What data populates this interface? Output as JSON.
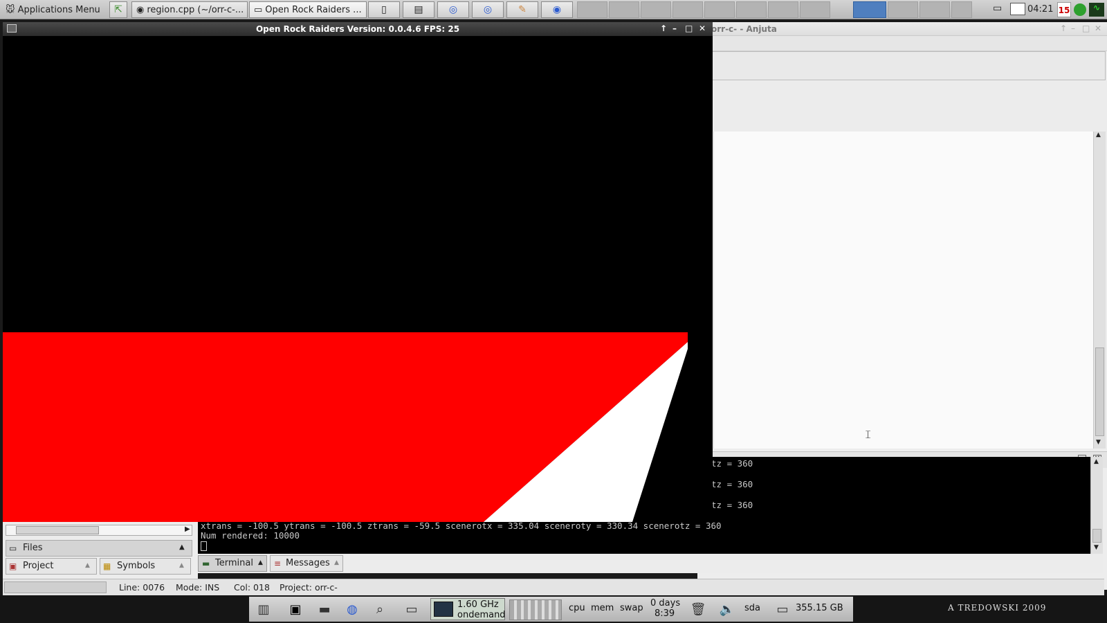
{
  "top_panel": {
    "apps_menu_label": "Applications Menu",
    "tasks": [
      {
        "label": "region.cpp (~/orr-c-..."
      },
      {
        "label": "Open Rock Raiders ..."
      }
    ],
    "clock": "04:21",
    "calendar_day": "15"
  },
  "game_window": {
    "title": "Open Rock Raiders Version: 0.0.4.6 FPS: 25",
    "colors": {
      "ground": "#ff0000",
      "wall": "#ffffff",
      "sky": "#000000"
    }
  },
  "anjuta": {
    "title_fragment": "orr-c- - Anjuta",
    "terminal_lines": [
      "tz = 360",
      "tz = 360",
      "tz = 360",
      "tz = 360"
    ],
    "terminal_full_line": "xtrans = -100.5 ytrans = -100.5 ztrans = -59.5 scenerotx = 335.04 sceneroty = 330.34 scenerotz = 360",
    "terminal_last": "Num rendered: 10000",
    "left_tabs": {
      "files": "Files",
      "project": "Project",
      "symbols": "Symbols"
    },
    "bottom_tabs": {
      "terminal": "Terminal",
      "messages": "Messages"
    },
    "status": {
      "line": "Line: 0076",
      "mode": "Mode: INS",
      "col": "Col: 018",
      "project": "Project: orr-c-"
    }
  },
  "bottom_panel": {
    "cpu_freq": "1.60 GHz",
    "governor": "ondemand",
    "cpu_label": "cpu",
    "mem_label": "mem",
    "swap_label": "swap",
    "uptime_days": "0 days",
    "uptime_time": "8:39",
    "disk_label": "sda",
    "disk_free": "355.15 GB",
    "watermark": "A TREDOWSKI 2009"
  }
}
